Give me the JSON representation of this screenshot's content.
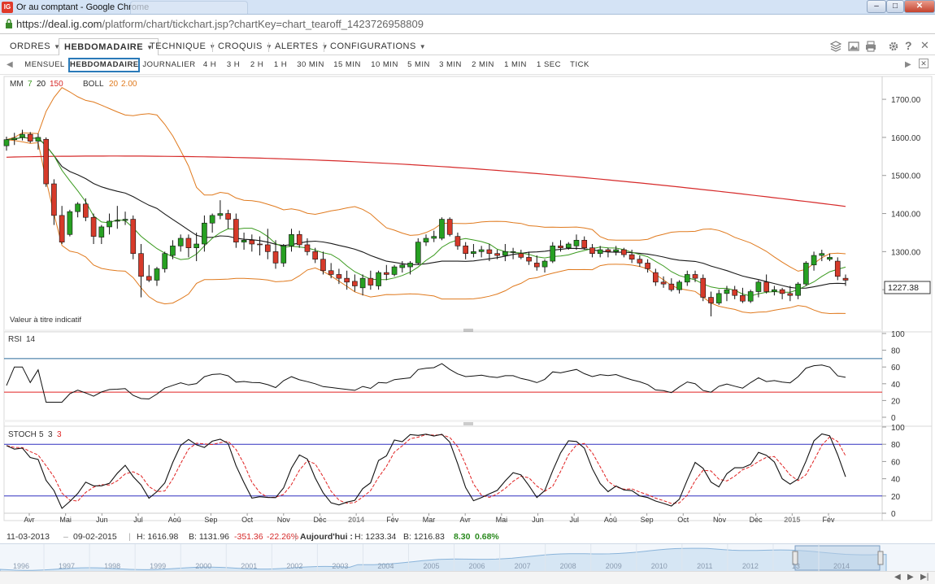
{
  "window": {
    "title": "Or au comptant - Google Chrome",
    "url_host": "https://deal.ig.com",
    "url_path": "/platform/chart/tickchart.jsp?chartKey=chart_tearoff_1423726958809",
    "favicon_text": "IG"
  },
  "menubar": {
    "items": [
      "ORDRES",
      "HEBDOMADAIRE",
      "TECHNIQUE",
      "CROQUIS",
      "ALERTES",
      "CONFIGURATIONS"
    ],
    "active_index": 1
  },
  "timeframes": {
    "items": [
      "MENSUEL",
      "HEBDOMADAIRE",
      "JOURNALIER",
      "4 H",
      "3 H",
      "2 H",
      "1 H",
      "30 MIN",
      "15 MIN",
      "10 MIN",
      "5 MIN",
      "3 MIN",
      "2 MIN",
      "1 MIN",
      "1 SEC",
      "TICK"
    ],
    "active_index": 1
  },
  "price_panel": {
    "ma_label": "MM",
    "ma_periods": [
      "7",
      "20",
      "150"
    ],
    "boll_label": "BOLL",
    "boll_params": [
      "20",
      "2.00"
    ],
    "note": "Valeur à titre indicatif",
    "current_price": "1227.38",
    "ylim": [
      1100,
      1760
    ],
    "y_ticks": [
      "1700.00",
      "1600.00",
      "1500.00",
      "1400.00",
      "1300.00",
      "1200.00"
    ]
  },
  "rsi_panel": {
    "label": "RSI",
    "period": "14",
    "ylim": [
      0,
      100
    ],
    "y_ticks": [
      "100",
      "80",
      "60",
      "40",
      "20",
      "0"
    ],
    "levels": [
      70,
      30
    ]
  },
  "stoch_panel": {
    "label": "STOCH",
    "params": [
      "5",
      "3",
      "3"
    ],
    "ylim": [
      0,
      100
    ],
    "y_ticks": [
      "100",
      "80",
      "60",
      "40",
      "20",
      "0"
    ],
    "levels": [
      80,
      20
    ]
  },
  "x_axis": {
    "labels": [
      "Avr",
      "Mai",
      "Jun",
      "Jul",
      "Aoû",
      "Sep",
      "Oct",
      "Nov",
      "Déc",
      "2014",
      "Fév",
      "Mar",
      "Avr",
      "Mai",
      "Jun",
      "Jul",
      "Aoû",
      "Sep",
      "Oct",
      "Nov",
      "Déc",
      "2015",
      "Fév"
    ],
    "bold_labels": [
      "2014",
      "2015"
    ]
  },
  "info": {
    "from": "11-03-2013",
    "to": "09-02-2015",
    "high": "H: 1616.98",
    "low": "B: 1131.96",
    "change": "-351.36",
    "change_pct": "-22.26%",
    "today_label": "Aujourd'hui :",
    "today_high": "H: 1233.34",
    "today_low": "B: 1216.83",
    "today_change": "8.30",
    "today_change_pct": "0.68%"
  },
  "navigator": {
    "years": [
      "1996",
      "1997",
      "1998",
      "1999",
      "2000",
      "2001",
      "2002",
      "2003",
      "2004",
      "2005",
      "2006",
      "2007",
      "2008",
      "2009",
      "2010",
      "2011",
      "2012",
      "13",
      "2014"
    ]
  },
  "chart_data": {
    "type": "candlestick",
    "title": "",
    "period": "weekly",
    "range": [
      "11-03-2013",
      "09-02-2015"
    ],
    "candles": [
      [
        1578,
        1602,
        1565,
        1594
      ],
      [
        1594,
        1612,
        1580,
        1598
      ],
      [
        1600,
        1620,
        1592,
        1608
      ],
      [
        1608,
        1614,
        1585,
        1590
      ],
      [
        1590,
        1610,
        1568,
        1600
      ],
      [
        1595,
        1600,
        1470,
        1478
      ],
      [
        1478,
        1490,
        1370,
        1395
      ],
      [
        1395,
        1420,
        1320,
        1325
      ],
      [
        1345,
        1410,
        1340,
        1405
      ],
      [
        1405,
        1430,
        1390,
        1425
      ],
      [
        1425,
        1440,
        1380,
        1390
      ],
      [
        1390,
        1400,
        1320,
        1340
      ],
      [
        1338,
        1370,
        1320,
        1365
      ],
      [
        1365,
        1400,
        1345,
        1380
      ],
      [
        1380,
        1420,
        1360,
        1382
      ],
      [
        1382,
        1405,
        1370,
        1385
      ],
      [
        1385,
        1395,
        1280,
        1295
      ],
      [
        1295,
        1320,
        1180,
        1235
      ],
      [
        1235,
        1265,
        1220,
        1225
      ],
      [
        1225,
        1260,
        1210,
        1255
      ],
      [
        1255,
        1300,
        1245,
        1295
      ],
      [
        1290,
        1330,
        1280,
        1315
      ],
      [
        1315,
        1345,
        1300,
        1335
      ],
      [
        1335,
        1345,
        1285,
        1310
      ],
      [
        1310,
        1350,
        1275,
        1320
      ],
      [
        1320,
        1395,
        1300,
        1375
      ],
      [
        1375,
        1400,
        1350,
        1395
      ],
      [
        1395,
        1435,
        1385,
        1400
      ],
      [
        1400,
        1410,
        1360,
        1385
      ],
      [
        1385,
        1400,
        1310,
        1325
      ],
      [
        1325,
        1350,
        1305,
        1330
      ],
      [
        1330,
        1345,
        1300,
        1320
      ],
      [
        1320,
        1340,
        1290,
        1318
      ],
      [
        1318,
        1360,
        1280,
        1300
      ],
      [
        1300,
        1330,
        1255,
        1270
      ],
      [
        1270,
        1320,
        1260,
        1315
      ],
      [
        1315,
        1360,
        1300,
        1345
      ],
      [
        1345,
        1355,
        1310,
        1318
      ],
      [
        1318,
        1335,
        1290,
        1300
      ],
      [
        1300,
        1310,
        1270,
        1280
      ],
      [
        1280,
        1300,
        1240,
        1250
      ],
      [
        1250,
        1270,
        1230,
        1240
      ],
      [
        1240,
        1255,
        1215,
        1230
      ],
      [
        1230,
        1250,
        1200,
        1220
      ],
      [
        1222,
        1240,
        1195,
        1210
      ],
      [
        1205,
        1240,
        1185,
        1230
      ],
      [
        1230,
        1250,
        1200,
        1212
      ],
      [
        1210,
        1250,
        1200,
        1245
      ],
      [
        1245,
        1265,
        1225,
        1240
      ],
      [
        1240,
        1265,
        1235,
        1260
      ],
      [
        1258,
        1275,
        1245,
        1265
      ],
      [
        1260,
        1275,
        1240,
        1270
      ],
      [
        1270,
        1335,
        1265,
        1325
      ],
      [
        1325,
        1345,
        1315,
        1335
      ],
      [
        1335,
        1355,
        1325,
        1340
      ],
      [
        1335,
        1390,
        1330,
        1385
      ],
      [
        1385,
        1390,
        1340,
        1345
      ],
      [
        1340,
        1350,
        1305,
        1315
      ],
      [
        1315,
        1325,
        1280,
        1295
      ],
      [
        1295,
        1320,
        1285,
        1300
      ],
      [
        1300,
        1315,
        1285,
        1305
      ],
      [
        1305,
        1320,
        1275,
        1295
      ],
      [
        1295,
        1305,
        1280,
        1290
      ],
      [
        1290,
        1320,
        1275,
        1300
      ],
      [
        1300,
        1310,
        1280,
        1300
      ],
      [
        1295,
        1305,
        1280,
        1285
      ],
      [
        1285,
        1300,
        1265,
        1275
      ],
      [
        1270,
        1290,
        1250,
        1260
      ],
      [
        1260,
        1280,
        1245,
        1275
      ],
      [
        1275,
        1325,
        1270,
        1315
      ],
      [
        1315,
        1330,
        1300,
        1310
      ],
      [
        1310,
        1325,
        1305,
        1320
      ],
      [
        1315,
        1345,
        1305,
        1330
      ],
      [
        1330,
        1340,
        1305,
        1310
      ],
      [
        1310,
        1320,
        1285,
        1295
      ],
      [
        1295,
        1315,
        1285,
        1305
      ],
      [
        1305,
        1310,
        1285,
        1300
      ],
      [
        1300,
        1315,
        1290,
        1305
      ],
      [
        1305,
        1310,
        1285,
        1292
      ],
      [
        1292,
        1305,
        1270,
        1280
      ],
      [
        1280,
        1290,
        1260,
        1270
      ],
      [
        1270,
        1280,
        1245,
        1255
      ],
      [
        1245,
        1255,
        1210,
        1220
      ],
      [
        1220,
        1235,
        1205,
        1215
      ],
      [
        1215,
        1230,
        1195,
        1200
      ],
      [
        1200,
        1225,
        1190,
        1220
      ],
      [
        1220,
        1250,
        1210,
        1240
      ],
      [
        1240,
        1250,
        1220,
        1230
      ],
      [
        1230,
        1240,
        1170,
        1180
      ],
      [
        1180,
        1195,
        1130,
        1165
      ],
      [
        1165,
        1200,
        1160,
        1190
      ],
      [
        1190,
        1210,
        1170,
        1200
      ],
      [
        1200,
        1210,
        1175,
        1185
      ],
      [
        1185,
        1205,
        1165,
        1170
      ],
      [
        1170,
        1200,
        1165,
        1195
      ],
      [
        1195,
        1225,
        1180,
        1220
      ],
      [
        1220,
        1240,
        1190,
        1195
      ],
      [
        1195,
        1210,
        1185,
        1200
      ],
      [
        1200,
        1205,
        1175,
        1190
      ],
      [
        1190,
        1210,
        1170,
        1185
      ],
      [
        1185,
        1220,
        1175,
        1215
      ],
      [
        1215,
        1275,
        1210,
        1270
      ],
      [
        1265,
        1300,
        1250,
        1290
      ],
      [
        1290,
        1305,
        1275,
        1295
      ],
      [
        1280,
        1295,
        1275,
        1285
      ],
      [
        1275,
        1285,
        1225,
        1235
      ],
      [
        1230,
        1240,
        1210,
        1225
      ]
    ],
    "series": [
      {
        "name": "MM 7",
        "color": "#3a9a1e"
      },
      {
        "name": "MM 20",
        "color": "#1a1a1a"
      },
      {
        "name": "MM 150",
        "color": "#d62a2a"
      },
      {
        "name": "BOLL 20 2.00",
        "color": "#e07a1e"
      },
      {
        "name": "RSI 14",
        "color": "#111111"
      },
      {
        "name": "STOCH %K",
        "color": "#111111"
      },
      {
        "name": "STOCH %D",
        "color": "#e02020"
      }
    ]
  }
}
